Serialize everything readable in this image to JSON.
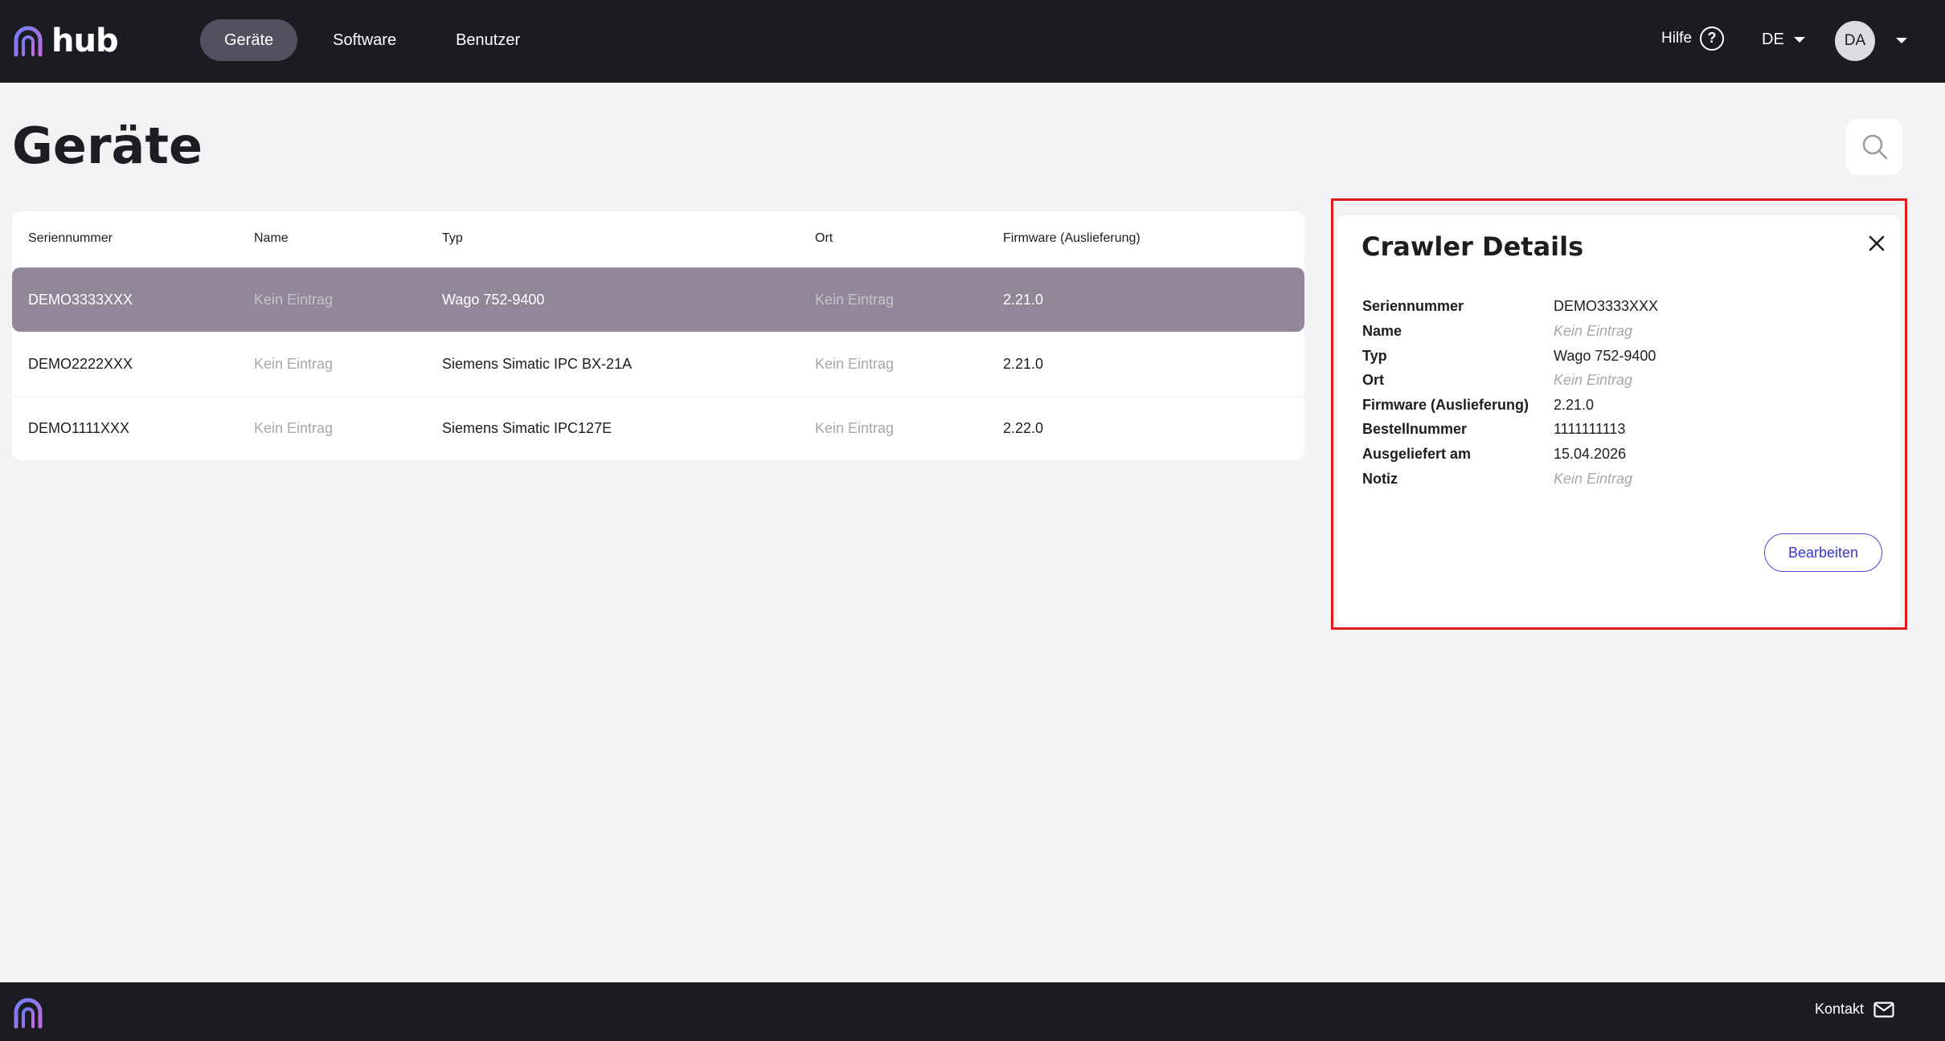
{
  "app": {
    "name": "hub"
  },
  "nav": {
    "items": [
      {
        "label": "Geräte",
        "active": true
      },
      {
        "label": "Software",
        "active": false
      },
      {
        "label": "Benutzer",
        "active": false
      }
    ]
  },
  "header": {
    "help_label": "Hilfe",
    "lang": "DE",
    "avatar_initials": "DA"
  },
  "page": {
    "title": "Geräte"
  },
  "table": {
    "columns": [
      "Seriennummer",
      "Name",
      "Typ",
      "Ort",
      "Firmware (Auslieferung)"
    ],
    "rows": [
      {
        "serial": "DEMO3333XXX",
        "name": "Kein Eintrag",
        "type": "Wago 752-9400",
        "location": "Kein Eintrag",
        "firmware": "2.21.0",
        "selected": true
      },
      {
        "serial": "DEMO2222XXX",
        "name": "Kein Eintrag",
        "type": "Siemens Simatic IPC BX-21A",
        "location": "Kein Eintrag",
        "firmware": "2.21.0",
        "selected": false
      },
      {
        "serial": "DEMO1111XXX",
        "name": "Kein Eintrag",
        "type": "Siemens Simatic IPC127E",
        "location": "Kein Eintrag",
        "firmware": "2.22.0",
        "selected": false
      }
    ]
  },
  "details": {
    "title": "Crawler Details",
    "fields": [
      {
        "label": "Seriennummer",
        "value": "DEMO3333XXX"
      },
      {
        "label": "Name",
        "value": "Kein Eintrag"
      },
      {
        "label": "Typ",
        "value": "Wago 752-9400"
      },
      {
        "label": "Ort",
        "value": "Kein Eintrag"
      },
      {
        "label": "Firmware (Auslieferung)",
        "value": "2.21.0"
      },
      {
        "label": "Bestellnummer",
        "value": "1111111113"
      },
      {
        "label": "Ausgeliefert am",
        "value": "15.04.2026"
      },
      {
        "label": "Notiz",
        "value": "Kein Eintrag"
      }
    ],
    "edit_label": "Bearbeiten"
  },
  "footer": {
    "contact_label": "Kontakt"
  },
  "colors": {
    "topbar": "#1b1c21",
    "selected_row": "#928699",
    "accent": "#4b47d6",
    "highlight": "#e01b1b"
  }
}
